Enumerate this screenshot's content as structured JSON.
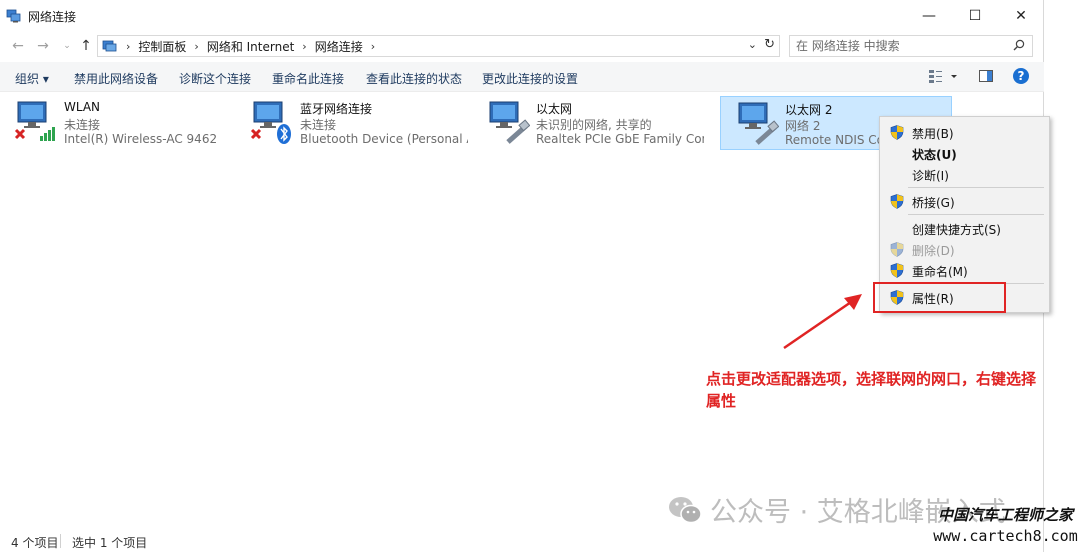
{
  "window": {
    "title": "网络连接",
    "minimize": "—",
    "maximize": "☐",
    "close": "✕"
  },
  "address": {
    "crumbs": [
      "控制面板",
      "网络和 Internet",
      "网络连接"
    ],
    "search_placeholder": "在 网络连接 中搜索"
  },
  "toolbar": {
    "organize": "组织 ▾",
    "disable_device": "禁用此网络设备",
    "diagnose": "诊断这个连接",
    "rename": "重命名此连接",
    "view_status": "查看此连接的状态",
    "change_settings": "更改此连接的设置"
  },
  "connections": [
    {
      "name": "WLAN",
      "status": "未连接",
      "device": "Intel(R) Wireless-AC 9462"
    },
    {
      "name": "蓝牙网络连接",
      "status": "未连接",
      "device": "Bluetooth Device (Personal Ar..."
    },
    {
      "name": "以太网",
      "status": "未识别的网络, 共享的",
      "device": "Realtek PCIe GbE Family Contr..."
    },
    {
      "name": "以太网 2",
      "status": "网络 2",
      "device": "Remote NDIS Comp"
    }
  ],
  "context_menu": {
    "disable": "禁用(B)",
    "status": "状态(U)",
    "diagnose": "诊断(I)",
    "bridge": "桥接(G)",
    "shortcut": "创建快捷方式(S)",
    "delete": "删除(D)",
    "rename": "重命名(M)",
    "properties": "属性(R)"
  },
  "annotation": "点击更改适配器选项，选择联网的网口，右键选择属性",
  "statusbar": {
    "count": "4 个项目",
    "selected": "选中 1 个项目"
  },
  "watermark": {
    "text": "公众号 · 艾格北峰嵌入式",
    "site_title": "中国汽车工程师之家",
    "site_url": "www.cartech8.com"
  },
  "colors": {
    "accent_red": "#e02424",
    "selection": "#cce8ff",
    "help_blue": "#1a6fd1"
  }
}
